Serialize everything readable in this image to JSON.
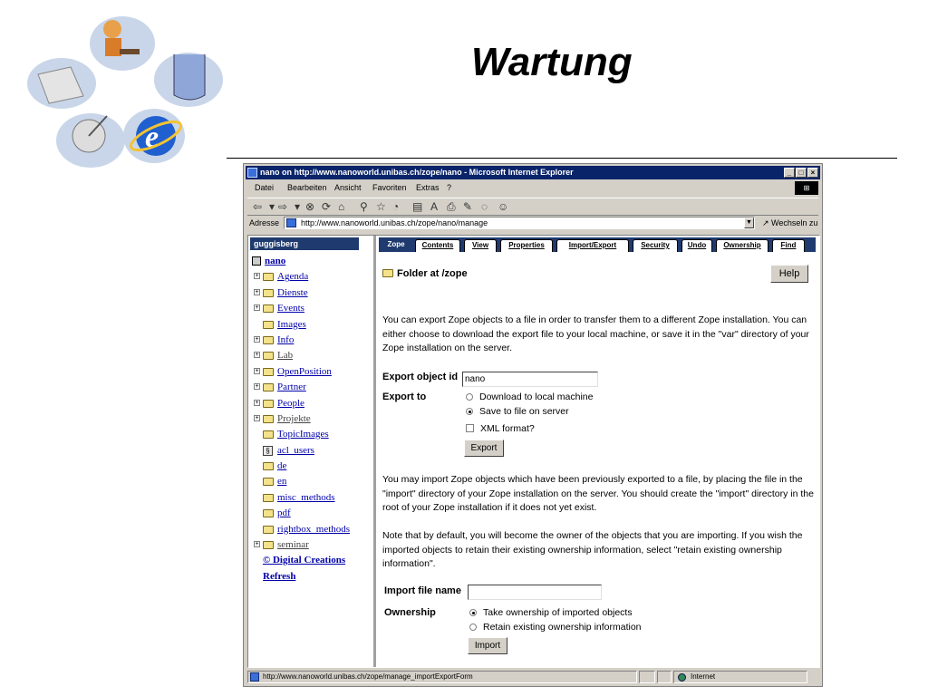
{
  "slide": {
    "title": "Wartung"
  },
  "window": {
    "title": "nano on http://www.nanoworld.unibas.ch/zope/nano - Microsoft Internet Explorer",
    "controls": [
      "_",
      "□",
      "×"
    ]
  },
  "menu": [
    "Datei",
    "Bearbeiten",
    "Ansicht",
    "Favoriten",
    "Extras",
    "?"
  ],
  "address": {
    "label": "Adresse",
    "url": "http://www.nanoworld.unibas.ch/zope/nano/manage",
    "go": "Wechseln zu"
  },
  "sidebar": {
    "user": "guggisberg",
    "root": "nano",
    "items": [
      {
        "label": "Agenda",
        "expandable": true
      },
      {
        "label": "Dienste",
        "expandable": true
      },
      {
        "label": "Events",
        "expandable": true
      },
      {
        "label": "Images",
        "expandable": false
      },
      {
        "label": "Info",
        "expandable": true
      },
      {
        "label": "Lab",
        "expandable": true
      },
      {
        "label": "OpenPosition",
        "expandable": true
      },
      {
        "label": "Partner",
        "expandable": true
      },
      {
        "label": "People",
        "expandable": true
      },
      {
        "label": "Projekte",
        "expandable": true
      },
      {
        "label": "TopicImages",
        "expandable": false
      },
      {
        "label": "acl_users",
        "expandable": false
      },
      {
        "label": "de",
        "expandable": false
      },
      {
        "label": "en",
        "expandable": false
      },
      {
        "label": "misc_methods",
        "expandable": false
      },
      {
        "label": "pdf",
        "expandable": false
      },
      {
        "label": "rightbox_methods",
        "expandable": false
      },
      {
        "label": "seminar",
        "expandable": true
      }
    ],
    "copyright": "© Digital Creations",
    "refresh": "Refresh"
  },
  "tabs": [
    "Zope",
    "Contents",
    "View",
    "Properties",
    "Import/Export",
    "Security",
    "Undo",
    "Ownership",
    "Find"
  ],
  "main": {
    "heading": "Folder at /zope",
    "help": "Help",
    "export_intro": "You can export Zope objects to a file in order to transfer them to a different Zope installation. You can either choose to download the export file to your local machine, or save it in the \"var\" directory of your Zope installation on the server.",
    "export_id_label": "Export object id",
    "export_id_value": "nano",
    "export_to_label": "Export to",
    "export_options": [
      "Download to local machine",
      "Save to file on server"
    ],
    "export_selected": 1,
    "xml_label": "XML format?",
    "export_button": "Export",
    "import_intro": "You may import Zope objects which have been previously exported to a file, by placing the file in the \"import\" directory of your Zope installation on the server. You should create the \"import\" directory in the root of your Zope installation if it does not yet exist.",
    "ownership_note": "Note that by default, you will become the owner of the objects that you are importing. If you wish the imported objects to retain their existing ownership information, select \"retain existing ownership information\".",
    "import_file_label": "Import file name",
    "import_file_value": "",
    "ownership_label": "Ownership",
    "ownership_options": [
      "Take ownership of imported objects",
      "Retain existing ownership information"
    ],
    "ownership_selected": 0,
    "import_button": "Import"
  },
  "status": {
    "url": "http://www.nanoworld.unibas.ch/zope/manage_importExportForm",
    "zone": "Internet"
  }
}
